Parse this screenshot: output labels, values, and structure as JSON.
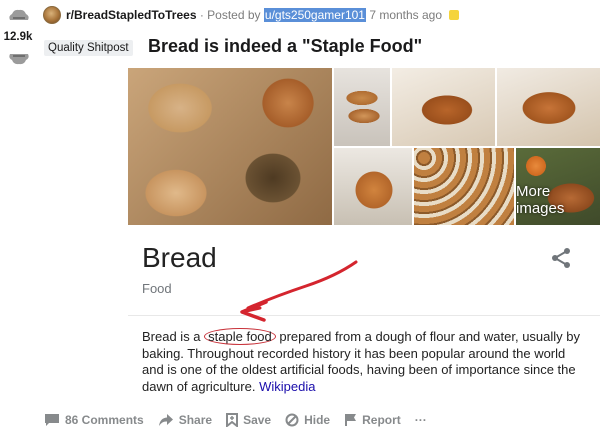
{
  "post": {
    "score": "12.9k",
    "subreddit": "r/BreadStapledToTrees",
    "posted_by": "· Posted by",
    "username": "u/gts250gamer101",
    "time": "7 months ago",
    "flair": "Quality Shitpost",
    "title": "Bread is indeed a \"Staple Food\""
  },
  "knowledge_panel": {
    "more_images": "More images",
    "title": "Bread",
    "subtitle": "Food",
    "desc_prefix": "Bread is a ",
    "desc_circled": "staple food",
    "desc_suffix": " prepared from a dough of flour and water, usually by baking. Throughout recorded history it has been popular around the world and is one of the oldest artificial foods, having been of importance since the dawn of agriculture. ",
    "source_link": "Wikipedia"
  },
  "actions": {
    "comments": "86 Comments",
    "share": "Share",
    "save": "Save",
    "hide": "Hide",
    "report": "Report",
    "more": "···"
  },
  "colors": {
    "annotation_red": "#d4252e",
    "username_highlight": "#5a8fd8",
    "link": "#1a0dab"
  },
  "icons": [
    "upvote-icon",
    "downvote-icon",
    "share-icon",
    "comment-icon",
    "share-arrow-icon",
    "save-icon",
    "hide-icon",
    "report-flag-icon"
  ]
}
